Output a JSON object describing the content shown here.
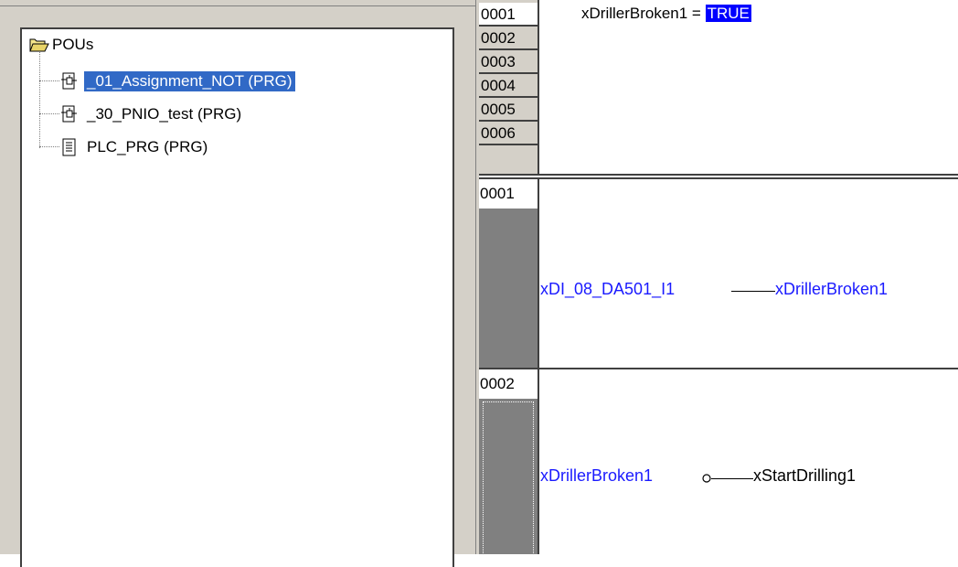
{
  "tree": {
    "root": {
      "label": "POUs",
      "icon": "folder-open-icon"
    },
    "items": [
      {
        "label": "_01_Assignment_NOT (PRG)",
        "icon": "program-icon",
        "selected": true
      },
      {
        "label": "_30_PNIO_test (PRG)",
        "icon": "program-icon",
        "selected": false
      },
      {
        "label": "PLC_PRG (PRG)",
        "icon": "document-icon",
        "selected": false
      }
    ]
  },
  "declarations": {
    "line_numbers": [
      "0001",
      "0002",
      "0003",
      "0004",
      "0005",
      "0006"
    ],
    "line1_variable": "xDrillerBroken1 =",
    "line1_value": "TRUE"
  },
  "networks": [
    {
      "number": "0001",
      "input": "xDI_08_DA501_I1",
      "output": "xDrillerBroken1",
      "negated": false
    },
    {
      "number": "0002",
      "input": "xDrillerBroken1",
      "output": "xStartDrilling1",
      "negated": true
    }
  ],
  "colors": {
    "selection": "#3169c6",
    "variable_blue": "#1a1aff",
    "value_highlight": "#0000ff",
    "gutter_gray": "#808080"
  }
}
